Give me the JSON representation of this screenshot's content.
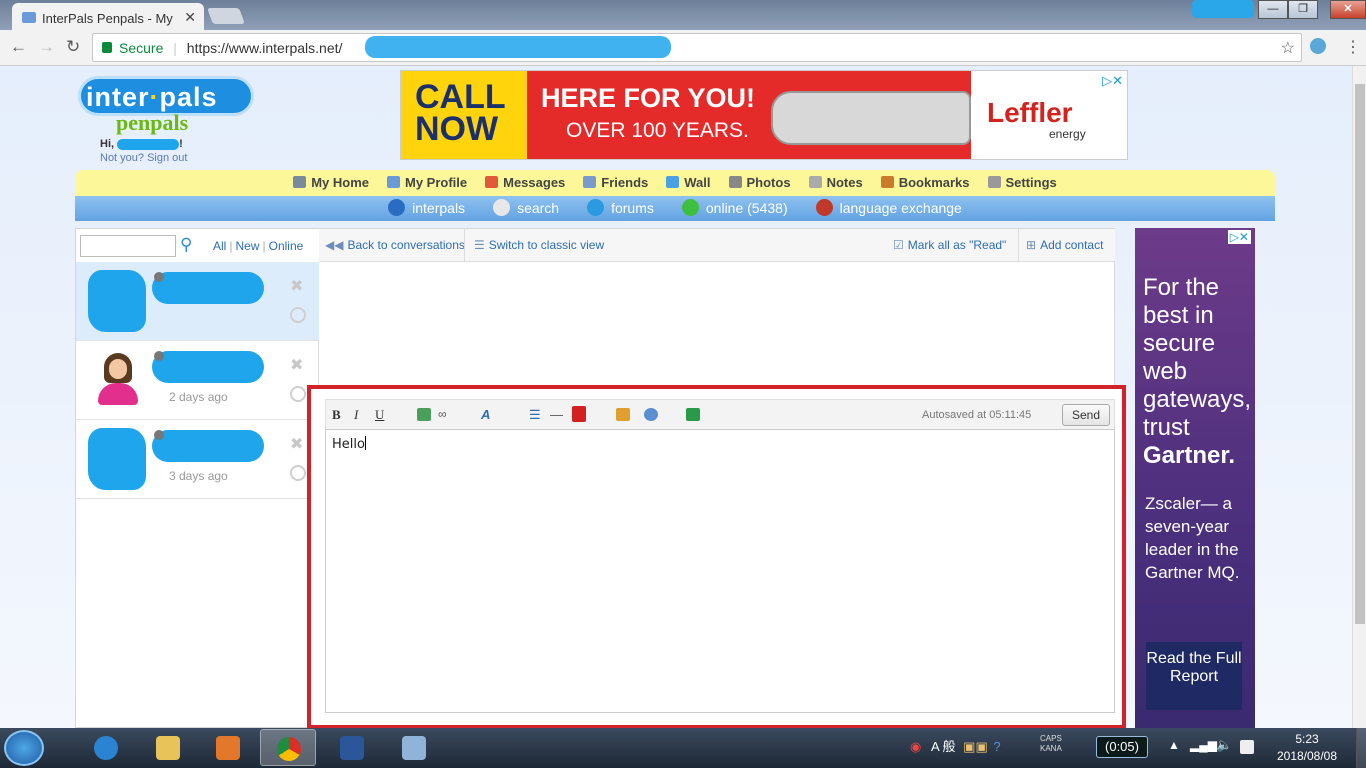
{
  "browser": {
    "tab_title": "InterPals Penpals - My",
    "tab_close": "✕",
    "url_secure": "Secure",
    "url": "https://www.interpals.net/",
    "window_min": "—",
    "window_max": "❐",
    "window_close": "✕"
  },
  "header": {
    "logo_text_1a": "inter",
    "logo_text_1b": "pals",
    "logo_text_2": "penpals",
    "greeting": "Hi,",
    "greeting_end": "!",
    "signout": "Not you? Sign out"
  },
  "ad_banner": {
    "call_now": "CALL NOW",
    "headline": "HERE FOR YOU!",
    "sub": "OVER 100 YEARS.",
    "brand": "Leffler",
    "brand_sub": "energy"
  },
  "nav_primary": [
    {
      "label": "My Home",
      "icon": "home-icon",
      "color": "#7a8a9a"
    },
    {
      "label": "My Profile",
      "icon": "profile-icon",
      "color": "#6a9bd8"
    },
    {
      "label": "Messages",
      "icon": "envelope-icon",
      "color": "#e05a3a"
    },
    {
      "label": "Friends",
      "icon": "friends-icon",
      "color": "#7a9acb"
    },
    {
      "label": "Wall",
      "icon": "wall-icon",
      "color": "#4aa0e0"
    },
    {
      "label": "Photos",
      "icon": "photos-icon",
      "color": "#888"
    },
    {
      "label": "Notes",
      "icon": "notes-icon",
      "color": "#aaa"
    },
    {
      "label": "Bookmarks",
      "icon": "bookmarks-icon",
      "color": "#c97b2b"
    },
    {
      "label": "Settings",
      "icon": "settings-icon",
      "color": "#999"
    }
  ],
  "nav_secondary": [
    {
      "label": "interpals",
      "icon": "globe-icon",
      "color": "#2a6cc2"
    },
    {
      "label": "search",
      "icon": "search-icon",
      "color": "#e8e8e8"
    },
    {
      "label": "forums",
      "icon": "forums-icon",
      "color": "#2a9be0"
    },
    {
      "label": "online (5438)",
      "icon": "online-icon",
      "color": "#3fbf3f"
    },
    {
      "label": "language exchange",
      "icon": "flag-icon",
      "color": "#c0392b"
    }
  ],
  "messages": {
    "filters": [
      "All",
      "New",
      "Online"
    ],
    "back": "Back to conversations",
    "classic": "Switch to classic view",
    "mark_read": "Mark all as \"Read\"",
    "add_contact": "Add contact",
    "conversations": [
      {
        "time": "",
        "avatar": "hidden"
      },
      {
        "time": "2 days ago",
        "avatar": "female"
      },
      {
        "time": "3 days ago",
        "avatar": "hidden"
      }
    ]
  },
  "composer": {
    "bold": "B",
    "italic": "I",
    "underline": "U",
    "font": "A",
    "autosaved": "Autosaved at 05:11:45",
    "send": "Send",
    "text": "Hello"
  },
  "side_ad": {
    "line1": "For the best in secure web gateways, trust",
    "brand": "Gartner.",
    "line2": "Zscaler— a seven-year leader in the Gartner MQ.",
    "cta": "Read the Full Report"
  },
  "taskbar": {
    "ime": "A 般",
    "caps": "CAPS",
    "kana": "KANA",
    "timer": "(0:05)",
    "time": "5:23",
    "date": "2018/08/08"
  }
}
